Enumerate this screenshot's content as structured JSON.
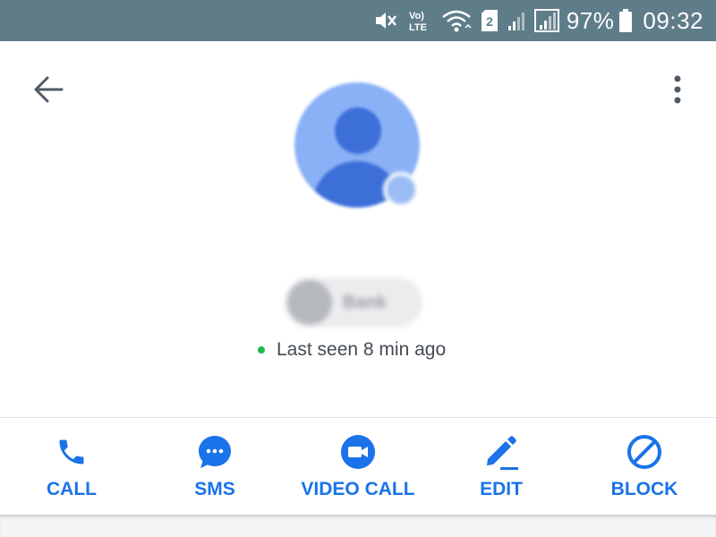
{
  "status_bar": {
    "battery_percent": "97%",
    "time": "09:32",
    "sim_slot": "2",
    "volte_label": "Vo) LTE",
    "icons": [
      "mute-icon",
      "volte-icon",
      "wifi-icon",
      "sim-2-icon",
      "signal-icon",
      "signal-icon",
      "battery-icon"
    ]
  },
  "header": {
    "back_icon": "arrow-left-icon",
    "more_icon": "more-vert-icon"
  },
  "contact": {
    "account_label": "Bank",
    "presence_text": "Last seen 8 min ago",
    "presence_color": "#1db954"
  },
  "actions": [
    {
      "label": "CALL",
      "icon": "phone-icon"
    },
    {
      "label": "SMS",
      "icon": "chat-bubble-icon"
    },
    {
      "label": "VIDEO CALL",
      "icon": "video-camera-icon"
    },
    {
      "label": "EDIT",
      "icon": "pencil-icon"
    },
    {
      "label": "BLOCK",
      "icon": "block-icon"
    }
  ],
  "colors": {
    "status_bar": "#5f7d89",
    "accent": "#1a73e8",
    "avatar": "#8ab0f6",
    "avatar_dark": "#3d6fd9"
  }
}
